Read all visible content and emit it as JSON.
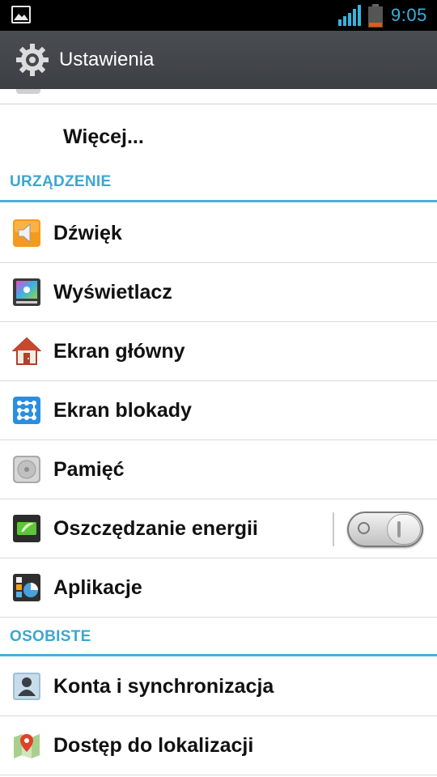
{
  "status_bar": {
    "time": "9:05",
    "icons": [
      "image-notification-icon",
      "signal-strength-icon",
      "battery-icon"
    ],
    "accent_color": "#35b4dd"
  },
  "action_bar": {
    "title": "Ustawienia",
    "icon": "settings-gear-icon"
  },
  "list": {
    "more_item": {
      "label": "Więcej..."
    },
    "sections": [
      {
        "title": "URZĄDZENIE",
        "items": [
          {
            "label": "Dźwięk",
            "icon": "speaker-icon"
          },
          {
            "label": "Wyświetlacz",
            "icon": "display-icon"
          },
          {
            "label": "Ekran główny",
            "icon": "home-icon"
          },
          {
            "label": "Ekran blokady",
            "icon": "lock-pattern-icon"
          },
          {
            "label": "Pamięć",
            "icon": "storage-icon"
          },
          {
            "label": "Oszczędzanie energii",
            "icon": "battery-saver-icon",
            "toggle": "off"
          },
          {
            "label": "Aplikacje",
            "icon": "apps-icon"
          }
        ]
      },
      {
        "title": "OSOBISTE",
        "items": [
          {
            "label": "Konta i synchronizacja",
            "icon": "account-icon"
          },
          {
            "label": "Dostęp do lokalizacji",
            "icon": "location-icon"
          }
        ]
      }
    ]
  },
  "colors": {
    "section_header": "#3ba7d2",
    "action_bar": "#45484d"
  }
}
